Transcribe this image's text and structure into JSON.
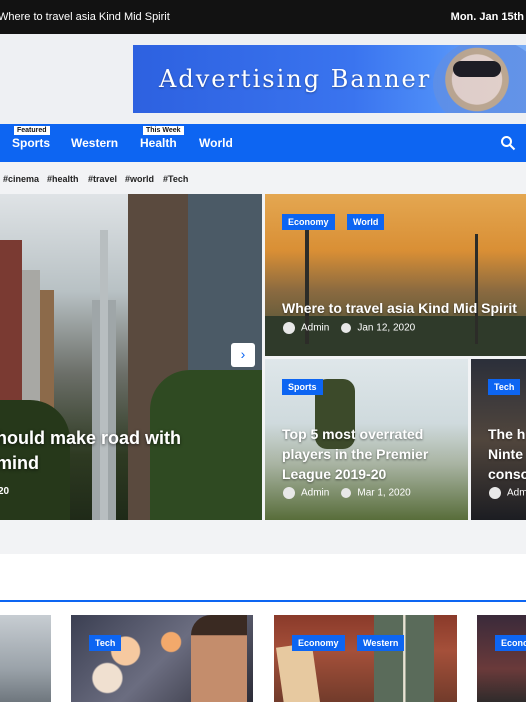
{
  "topbar": {
    "ticker": "Where to travel asia Kind Mid Spirit",
    "date": "Mon. Jan 15th"
  },
  "banner": {
    "text": "Advertising Banner"
  },
  "nav": {
    "items": [
      {
        "label": "Sports",
        "badge": "Featured"
      },
      {
        "label": "Western",
        "badge": ""
      },
      {
        "label": "Health",
        "badge": "This Week"
      },
      {
        "label": "World",
        "badge": ""
      }
    ],
    "search_icon": "search-icon"
  },
  "tags": [
    "#cinema",
    "#health",
    "#travel",
    "#world",
    "#Tech"
  ],
  "hero": {
    "title_line1": "hould make road with",
    "title_line2": "mind",
    "date_fragment": "20",
    "arrow": "›"
  },
  "cards": [
    {
      "categories": [
        "Economy",
        "World"
      ],
      "title": "Where to travel asia Kind Mid Spirit",
      "author": "Admin",
      "date": "Jan 12, 2020"
    },
    {
      "categories": [
        "Sports"
      ],
      "title": "Top 5 most overrated players in the Premier League 2019-20",
      "author": "Admin",
      "date": "Mar 1, 2020"
    },
    {
      "categories": [
        "Tech"
      ],
      "title": "The h Ninte conso",
      "author": "Adm",
      "date": ""
    }
  ],
  "lower_cards": [
    {
      "categories": []
    },
    {
      "categories": [
        "Tech"
      ]
    },
    {
      "categories": [
        "Economy",
        "Western"
      ]
    },
    {
      "categories": [
        "Econo"
      ]
    }
  ],
  "colors": {
    "accent": "#0d65f2",
    "topbar": "#121212"
  }
}
